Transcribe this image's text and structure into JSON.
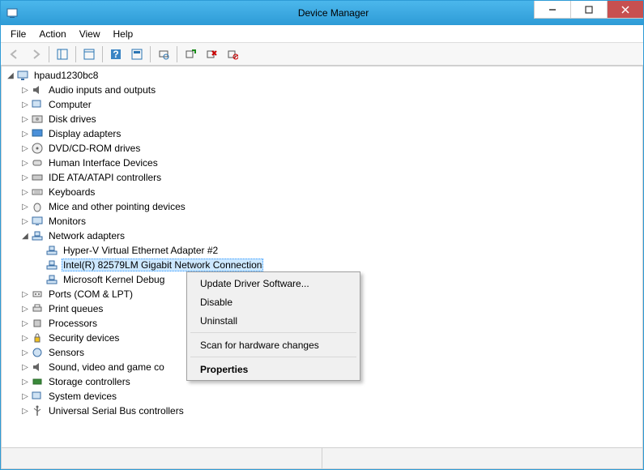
{
  "window": {
    "title": "Device Manager"
  },
  "menubar": {
    "file": "File",
    "action": "Action",
    "view": "View",
    "help": "Help"
  },
  "tree": {
    "root": "hpaud1230bc8",
    "audio": "Audio inputs and outputs",
    "computer": "Computer",
    "disk": "Disk drives",
    "display": "Display adapters",
    "dvd": "DVD/CD-ROM drives",
    "hid": "Human Interface Devices",
    "ide": "IDE ATA/ATAPI controllers",
    "keyboard": "Keyboards",
    "mouse": "Mice and other pointing devices",
    "monitor": "Monitors",
    "network": "Network adapters",
    "net_hyperv": "Hyper-V Virtual Ethernet Adapter #2",
    "net_intel": "Intel(R) 82579LM Gigabit Network Connection",
    "net_kernel": "Microsoft Kernel Debug",
    "ports": "Ports (COM & LPT)",
    "print": "Print queues",
    "processor": "Processors",
    "security": "Security devices",
    "sensor": "Sensors",
    "sound": "Sound, video and game co",
    "storage": "Storage controllers",
    "system": "System devices",
    "usb": "Universal Serial Bus controllers"
  },
  "context_menu": {
    "update": "Update Driver Software...",
    "disable": "Disable",
    "uninstall": "Uninstall",
    "scan": "Scan for hardware changes",
    "properties": "Properties"
  }
}
